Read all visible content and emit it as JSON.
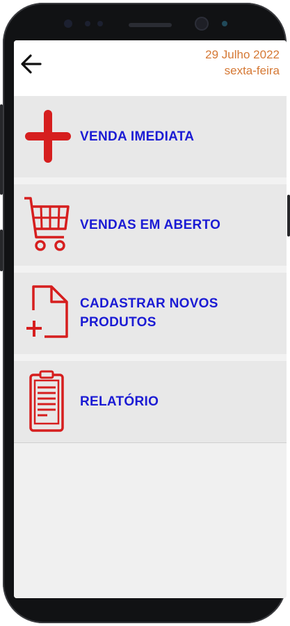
{
  "header": {
    "date": "29 Julho 2022",
    "weekday": "sexta-feira",
    "back_icon": "arrow-left-icon"
  },
  "menu": {
    "items": [
      {
        "label": "VENDA IMEDIATA",
        "icon": "plus-icon"
      },
      {
        "label": "VENDAS EM ABERTO",
        "icon": "shopping-cart-icon"
      },
      {
        "label": "CADASTRAR NOVOS PRODUTOS",
        "icon": "new-document-icon"
      },
      {
        "label": "RELATÓRIO",
        "icon": "clipboard-report-icon"
      }
    ]
  },
  "colors": {
    "accent_red": "#d61e1e",
    "label_blue": "#1b1bd4",
    "date_orange": "#d57834"
  }
}
